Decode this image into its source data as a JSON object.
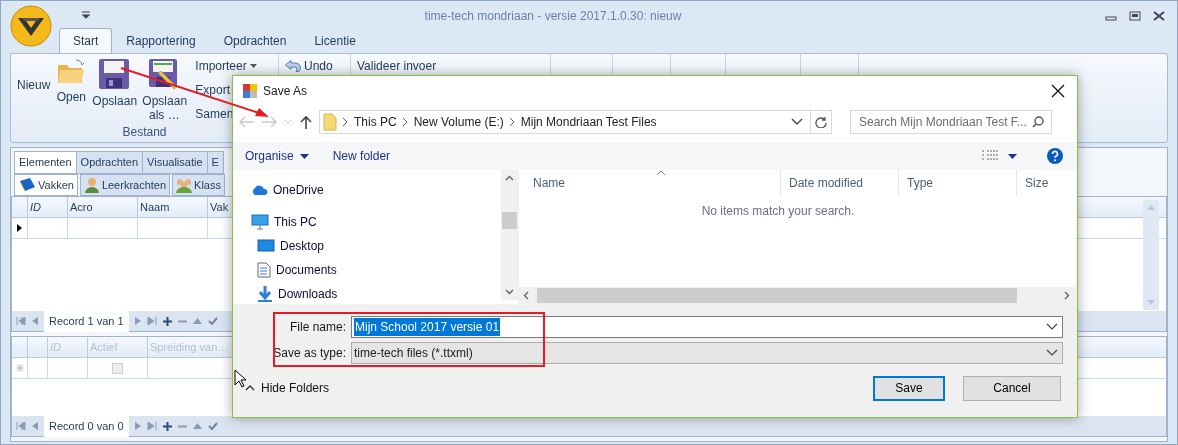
{
  "window": {
    "title": "time-tech mondriaan - versie 2017.1.0.30: nieuw"
  },
  "ribbon_tabs": [
    {
      "label": "Start",
      "selected": true
    },
    {
      "label": "Rapportering",
      "selected": false
    },
    {
      "label": "Opdrachten",
      "selected": false
    },
    {
      "label": "Licentie",
      "selected": false
    }
  ],
  "ribbon": {
    "buttons": [
      {
        "label": "Nieuw",
        "kind": "text"
      },
      {
        "label": "Open",
        "kind": "folder"
      },
      {
        "label": "Opslaan",
        "kind": "disk"
      },
      {
        "label": "Opslaan als …",
        "kind": "disk-edit"
      }
    ],
    "menu_items": [
      {
        "label": "Importeer",
        "dropdown": true
      },
      {
        "label": "Export",
        "dropdown": false
      },
      {
        "label": "Samen",
        "dropdown": false
      }
    ],
    "undo": "Undo",
    "validate": "Valideer invoer",
    "group_label": "Bestand"
  },
  "element_tabs": [
    {
      "label": "Elementen",
      "selected": true
    },
    {
      "label": "Opdrachten",
      "selected": false
    },
    {
      "label": "Visualisatie",
      "selected": false
    },
    {
      "label": "E",
      "selected": false
    }
  ],
  "sub_tabs": [
    {
      "label": "Vakken",
      "kind": "book",
      "selected": true
    },
    {
      "label": "Leerkrachten",
      "kind": "person",
      "selected": false
    },
    {
      "label": "Klass",
      "kind": "group",
      "selected": false
    }
  ],
  "grid_1": {
    "columns": [
      "ID",
      "Acro",
      "Naam",
      "Vak"
    ],
    "navigator": "Record 1 van 1"
  },
  "grid_2": {
    "columns": [
      "ID",
      "Actief",
      "Spreiding van…"
    ],
    "new_row_checked": false,
    "navigator": "Record 0 van 0"
  },
  "dialog": {
    "title": "Save As",
    "breadcrumb": [
      "This PC",
      "New Volume (E:)",
      "Mijn Mondriaan Test Files"
    ],
    "search": {
      "placeholder": "Search Mijn Mondriaan Test F..."
    },
    "organise": "Organise",
    "new_folder": "New folder",
    "nav_items": [
      {
        "label": "OneDrive",
        "kind": "cloud"
      },
      {
        "label": "This PC",
        "kind": "pc",
        "children": [
          {
            "label": "Desktop",
            "kind": "desktop"
          },
          {
            "label": "Documents",
            "kind": "documents"
          },
          {
            "label": "Downloads",
            "kind": "downloads"
          }
        ]
      }
    ],
    "columns": [
      "Name",
      "Date modified",
      "Type",
      "Size"
    ],
    "empty_message": "No items match your search.",
    "file_name": {
      "label": "File name:",
      "value": "Mijn School 2017 versie 01",
      "value_selected": true
    },
    "save_type": {
      "label": "Save as type:",
      "value": "time-tech files (*.ttxml)"
    },
    "hide_folders": "Hide Folders",
    "buttons": [
      {
        "label": "Save",
        "kind": "primary"
      },
      {
        "label": "Cancel",
        "kind": "secondary"
      }
    ]
  }
}
